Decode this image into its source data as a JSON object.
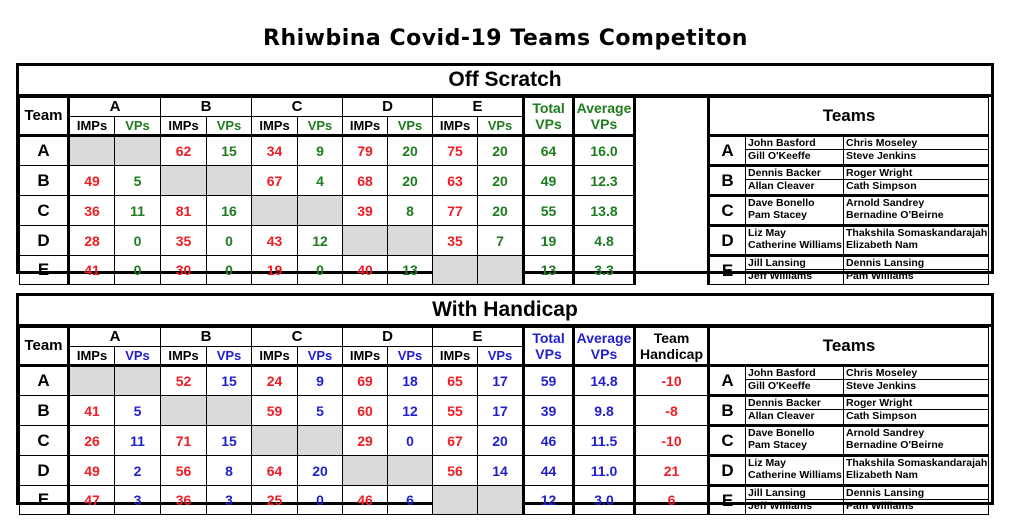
{
  "title": "Rhiwbina Covid-19 Teams Competiton",
  "team_letters": [
    "A",
    "B",
    "C",
    "D",
    "E"
  ],
  "labels": {
    "team": "Team",
    "imps": "IMPs",
    "vps": "VPs",
    "total": "Total",
    "total_sub": "VPs",
    "average": "Average",
    "average_sub": "VPs",
    "handicap": "Team",
    "handicap_sub": "Handicap",
    "teams": "Teams"
  },
  "colors": {
    "imps": "#ee1c24",
    "vps_scratch": "#1e7b1e",
    "vps_handicap": "#1f1fd0",
    "diagonal": "#d9d9d9"
  },
  "rosters": [
    {
      "team": "A",
      "players": [
        "John Basford",
        "Chris Moseley",
        "Gill O'Keeffe",
        "Steve Jenkins"
      ]
    },
    {
      "team": "B",
      "players": [
        "Dennis Backer",
        "Roger Wright",
        "Allan Cleaver",
        "Cath Simpson"
      ]
    },
    {
      "team": "C",
      "players": [
        "Dave Bonello",
        "Arnold Sandrey",
        "Pam Stacey",
        "Bernadine O'Beirne"
      ]
    },
    {
      "team": "D",
      "players": [
        "Liz May",
        "Thakshila Somaskandarajah",
        "Catherine Williams",
        "Elizabeth Nam"
      ]
    },
    {
      "team": "E",
      "players": [
        "Jill Lansing",
        "Dennis Lansing",
        "Jeff Williams",
        "Pam Williams"
      ]
    }
  ],
  "off_scratch": {
    "title": "Off Scratch",
    "rows": [
      {
        "team": "A",
        "cells": [
          [
            "",
            ""
          ],
          [
            "62",
            "15"
          ],
          [
            "34",
            "9"
          ],
          [
            "79",
            "20"
          ],
          [
            "75",
            "20"
          ]
        ],
        "total": "64",
        "average": "16.0"
      },
      {
        "team": "B",
        "cells": [
          [
            "49",
            "5"
          ],
          [
            "",
            ""
          ],
          [
            "67",
            "4"
          ],
          [
            "68",
            "20"
          ],
          [
            "63",
            "20"
          ]
        ],
        "total": "49",
        "average": "12.3"
      },
      {
        "team": "C",
        "cells": [
          [
            "36",
            "11"
          ],
          [
            "81",
            "16"
          ],
          [
            "",
            ""
          ],
          [
            "39",
            "8"
          ],
          [
            "77",
            "20"
          ]
        ],
        "total": "55",
        "average": "13.8"
      },
      {
        "team": "D",
        "cells": [
          [
            "28",
            "0"
          ],
          [
            "35",
            "0"
          ],
          [
            "43",
            "12"
          ],
          [
            "",
            ""
          ],
          [
            "35",
            "7"
          ]
        ],
        "total": "19",
        "average": "4.8"
      },
      {
        "team": "E",
        "cells": [
          [
            "41",
            "0"
          ],
          [
            "30",
            "0"
          ],
          [
            "19",
            "0"
          ],
          [
            "40",
            "13"
          ],
          [
            "",
            ""
          ]
        ],
        "total": "13",
        "average": "3.3"
      }
    ]
  },
  "with_handicap": {
    "title": "With Handicap",
    "rows": [
      {
        "team": "A",
        "cells": [
          [
            "",
            ""
          ],
          [
            "52",
            "15"
          ],
          [
            "24",
            "9"
          ],
          [
            "69",
            "18"
          ],
          [
            "65",
            "17"
          ]
        ],
        "total": "59",
        "average": "14.8",
        "handicap": "-10"
      },
      {
        "team": "B",
        "cells": [
          [
            "41",
            "5"
          ],
          [
            "",
            ""
          ],
          [
            "59",
            "5"
          ],
          [
            "60",
            "12"
          ],
          [
            "55",
            "17"
          ]
        ],
        "total": "39",
        "average": "9.8",
        "handicap": "-8"
      },
      {
        "team": "C",
        "cells": [
          [
            "26",
            "11"
          ],
          [
            "71",
            "15"
          ],
          [
            "",
            ""
          ],
          [
            "29",
            "0"
          ],
          [
            "67",
            "20"
          ]
        ],
        "total": "46",
        "average": "11.5",
        "handicap": "-10"
      },
      {
        "team": "D",
        "cells": [
          [
            "49",
            "2"
          ],
          [
            "56",
            "8"
          ],
          [
            "64",
            "20"
          ],
          [
            "",
            ""
          ],
          [
            "56",
            "14"
          ]
        ],
        "total": "44",
        "average": "11.0",
        "handicap": "21"
      },
      {
        "team": "E",
        "cells": [
          [
            "47",
            "3"
          ],
          [
            "36",
            "3"
          ],
          [
            "25",
            "0"
          ],
          [
            "46",
            "6"
          ],
          [
            "",
            ""
          ]
        ],
        "total": "12",
        "average": "3.0",
        "handicap": "6"
      }
    ]
  }
}
